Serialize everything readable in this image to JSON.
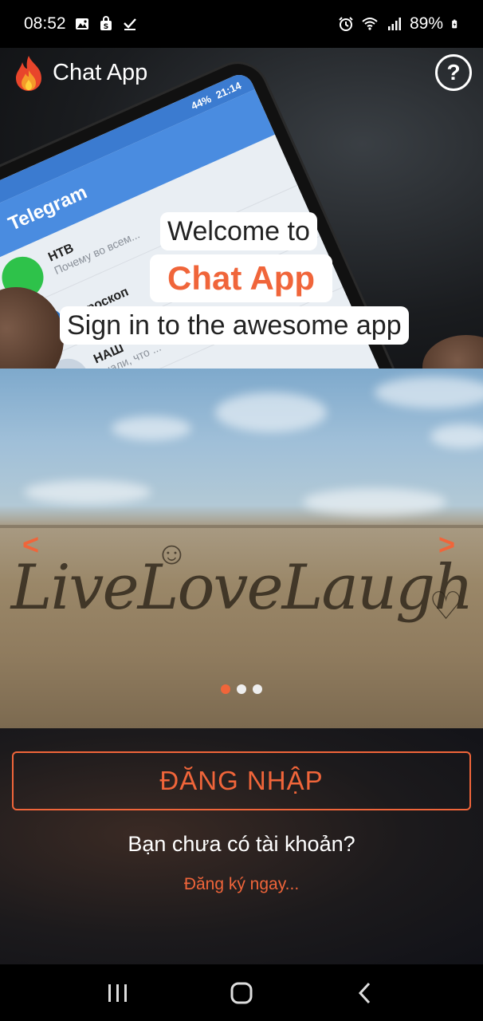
{
  "status_bar": {
    "time": "08:52",
    "battery": "89%",
    "left_icons": [
      "image-icon",
      "shopping-bag-icon",
      "checkmark-icon"
    ],
    "right_icons": [
      "alarm-icon",
      "wifi-icon",
      "signal-icon",
      "battery-charging-icon"
    ]
  },
  "header": {
    "app_title": "Chat App",
    "help_label": "?",
    "logo_icon": "flame-icon"
  },
  "hero": {
    "welcome_text": "Welcome to",
    "brand_text": "Chat App",
    "subtitle": "Sign in to the awesome app",
    "background_app": {
      "title": "Telegram",
      "time": "21:14",
      "battery": "44%",
      "chats": [
        {
          "name": "НТВ",
          "preview": "Почему во всем..."
        },
        {
          "name": "Гороскоп",
          "preview": ""
        },
        {
          "name": "НАШ",
          "preview": "знали, что ..."
        }
      ]
    }
  },
  "carousel": {
    "image_caption": "LiveLoveLaugh",
    "prev_label": "<",
    "next_label": ">",
    "slide_count": 3,
    "active_index": 0
  },
  "auth": {
    "login_label": "ĐĂNG NHẬP",
    "no_account_text": "Bạn chưa có tài khoản?",
    "register_link": "Đăng ký ngay..."
  },
  "nav_bar": {
    "buttons": [
      "recent-apps-icon",
      "home-icon",
      "back-icon"
    ]
  },
  "colors": {
    "accent": "#f0653a",
    "status_bar": "#000000",
    "white": "#ffffff"
  }
}
